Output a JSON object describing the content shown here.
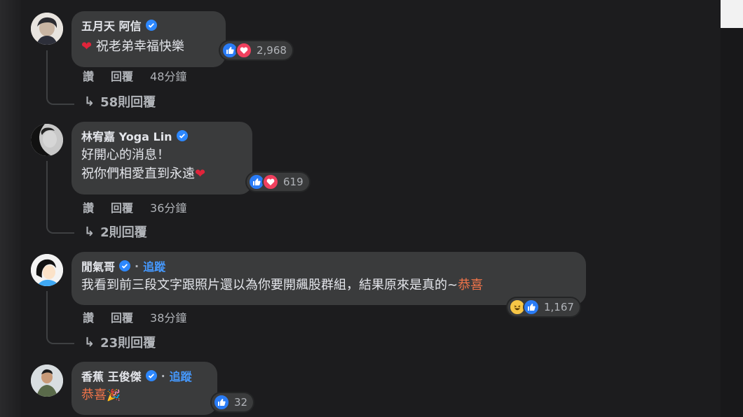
{
  "comments": [
    {
      "name": "五月天 阿信",
      "text_lines": [
        "祝老弟幸福快樂"
      ],
      "reaction_count": "2,968",
      "actions": {
        "like": "讚",
        "reply": "回覆",
        "time": "48分鐘"
      },
      "replies_label": "58則回覆"
    },
    {
      "name": "林宥嘉 Yoga Lin",
      "text_lines": [
        "好開心的消息！",
        "祝你們相愛直到永遠"
      ],
      "reaction_count": "619",
      "actions": {
        "like": "讚",
        "reply": "回覆",
        "time": "36分鐘"
      },
      "replies_label": "2則回覆"
    },
    {
      "name": "閒氣哥",
      "follow": "追蹤",
      "text_main": "我看到前三段文字跟照片還以為你要開飆股群組，結果原來是真的~",
      "text_highlight": "恭喜",
      "reaction_count": "1,167",
      "actions": {
        "like": "讚",
        "reply": "回覆",
        "time": "38分鐘"
      },
      "replies_label": "23則回覆"
    },
    {
      "name": "香蕉 王俊傑",
      "follow": "追蹤",
      "text_highlight": "恭喜",
      "reaction_count": "32"
    }
  ],
  "colors": {
    "bubble": "#3a3b3c",
    "background": "#1c1c1e",
    "link": "#4599ff",
    "verified": "#2d88ff",
    "like": "#2a7cf6",
    "love": "#f0405e"
  }
}
